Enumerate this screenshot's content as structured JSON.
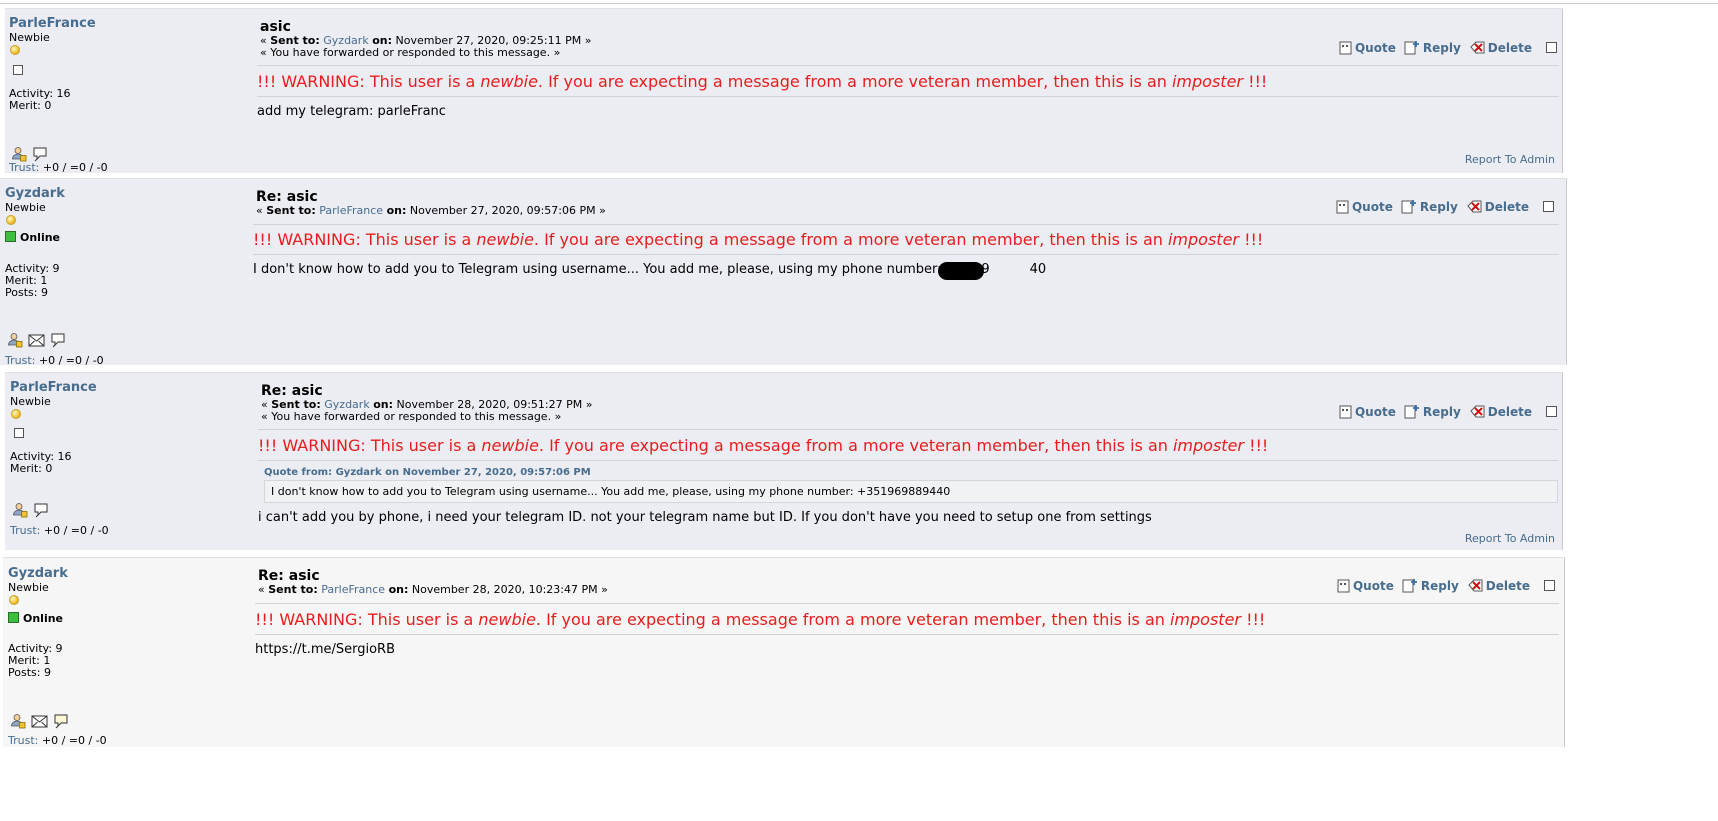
{
  "actions": {
    "quote": "Quote",
    "reply": "Reply",
    "delete": "Delete"
  },
  "warning": {
    "prefix": "!!! WARNING: This user is a ",
    "newbie": "newbie",
    "middle": ". If you are expecting a message from a more veteran member, then this is an ",
    "imposter": "imposter",
    "suffix": " !!!"
  },
  "labels": {
    "sent_to": "Sent to:",
    "on": "on:",
    "open_quote": "«",
    "close_quote": "»",
    "trust": "Trust:",
    "online": "Online",
    "report": "Report To Admin"
  },
  "messages": [
    {
      "poster": {
        "name": "ParleFrance",
        "rank": "Newbie",
        "activity": "Activity: 16",
        "merit": "Merit: 0",
        "posts": "",
        "trust": "+0 / =0 / -0"
      },
      "subject": "asic",
      "recipient": "Gyzdark",
      "date": "November 27, 2020, 09:25:11 PM",
      "forwarded": "« You have forwarded or responded to this message. »",
      "body": "add my telegram: parleFranc"
    },
    {
      "poster": {
        "name": "Gyzdark",
        "rank": "Newbie",
        "activity": "Activity: 9",
        "merit": "Merit: 1",
        "posts": "Posts: 9",
        "trust": "+0 / =0 / -0"
      },
      "subject": "Re: asic",
      "recipient": "ParleFrance",
      "date": "November 27, 2020, 09:57:06 PM",
      "body": "I don't know how to add you to Telegram using username... You add me, please, using my phone number: +3519",
      "body_tail": "40"
    },
    {
      "poster": {
        "name": "ParleFrance",
        "rank": "Newbie",
        "activity": "Activity: 16",
        "merit": "Merit: 0",
        "posts": "",
        "trust": "+0 / =0 / -0"
      },
      "subject": "Re: asic",
      "recipient": "Gyzdark",
      "date": "November 28, 2020, 09:51:27 PM",
      "forwarded": "« You have forwarded or responded to this message. »",
      "quote_header": "Quote from: Gyzdark on November 27, 2020, 09:57:06 PM",
      "quote_text": "I don't know how to add you to Telegram using username... You add me, please, using my phone number: +351969889440",
      "body": "i can't add you by phone, i need your telegram ID. not your telegram name but ID. If you don't have you need to setup one from settings"
    },
    {
      "poster": {
        "name": "Gyzdark",
        "rank": "Newbie",
        "activity": "Activity: 9",
        "merit": "Merit: 1",
        "posts": "Posts: 9",
        "trust": "+0 / =0 / -0"
      },
      "subject": "Re: asic",
      "recipient": "ParleFrance",
      "date": "November 28, 2020, 10:23:47 PM",
      "body": "https://t.me/SergioRB"
    }
  ],
  "icons": [
    "profile-icon",
    "email-icon",
    "pm-icon",
    "quote-icon",
    "reply-icon",
    "delete-icon",
    "coin-icon"
  ]
}
